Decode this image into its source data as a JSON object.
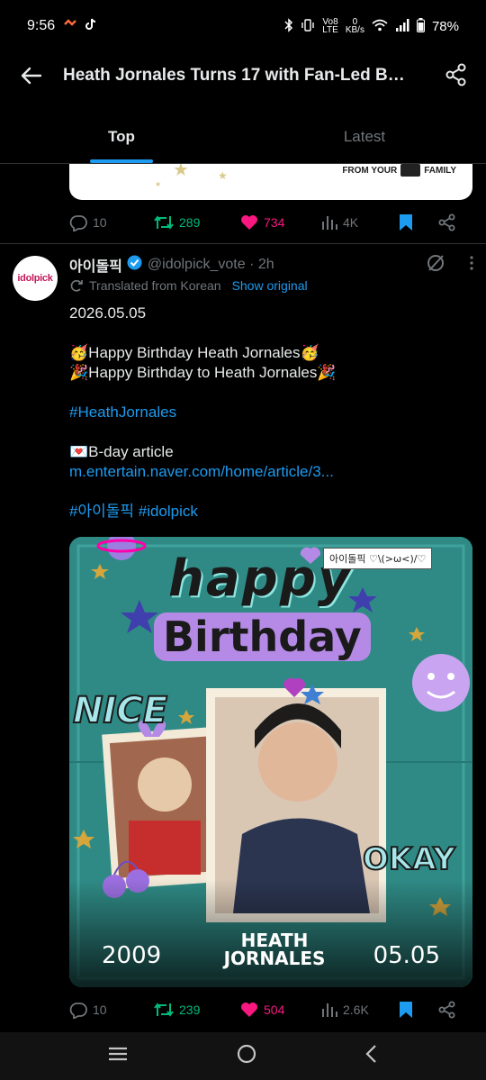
{
  "status": {
    "time": "9:56",
    "net_top": "Vo8",
    "net_bottom": "LTE",
    "speed_top": "0",
    "speed_bottom": "KB/s",
    "battery": "78%"
  },
  "header": {
    "title": "Heath Jornales Turns 17 with Fan-Led Bi..."
  },
  "tabs": [
    {
      "label": "Top",
      "active": true
    },
    {
      "label": "Latest",
      "active": false
    }
  ],
  "prev_card": {
    "caption_left": "FROM YOUR",
    "caption_right": "FAMILY"
  },
  "prev_actions": {
    "replies": "10",
    "reposts": "289",
    "likes": "734",
    "views": "4K"
  },
  "tweet": {
    "avatar_text": "idolpick",
    "author": "아이돌픽",
    "handle": "@idolpick_vote · 2h",
    "translated_label": "Translated from Korean",
    "show_original": "Show original",
    "lines": {
      "date": "2026.05.05",
      "line1": "🥳Happy Birthday Heath Jornales🥳",
      "line2": "🎉Happy Birthday to Heath Jornales🎉",
      "hashtag1": "#HeathJornales",
      "article_label": "💌B-day article",
      "article_link": "m.entertain.naver.com/home/article/3...",
      "hashtags2": "#아이돌픽 #idolpick"
    },
    "media": {
      "happy": "happy",
      "birthday": "Birthday",
      "tag": "아이돌픽 ♡\\(>ω<)/♡",
      "nice": "NICE",
      "okay": "OKAY",
      "year": "2009",
      "name_line1": "HEATH",
      "name_line2": "JORNALES",
      "date": "05.05"
    },
    "actions": {
      "replies": "10",
      "reposts": "239",
      "likes": "504",
      "views": "2.6K"
    }
  },
  "colors": {
    "accent": "#1d9bf0",
    "repost": "#00ba7c",
    "like": "#f91880",
    "muted": "#71767b"
  }
}
